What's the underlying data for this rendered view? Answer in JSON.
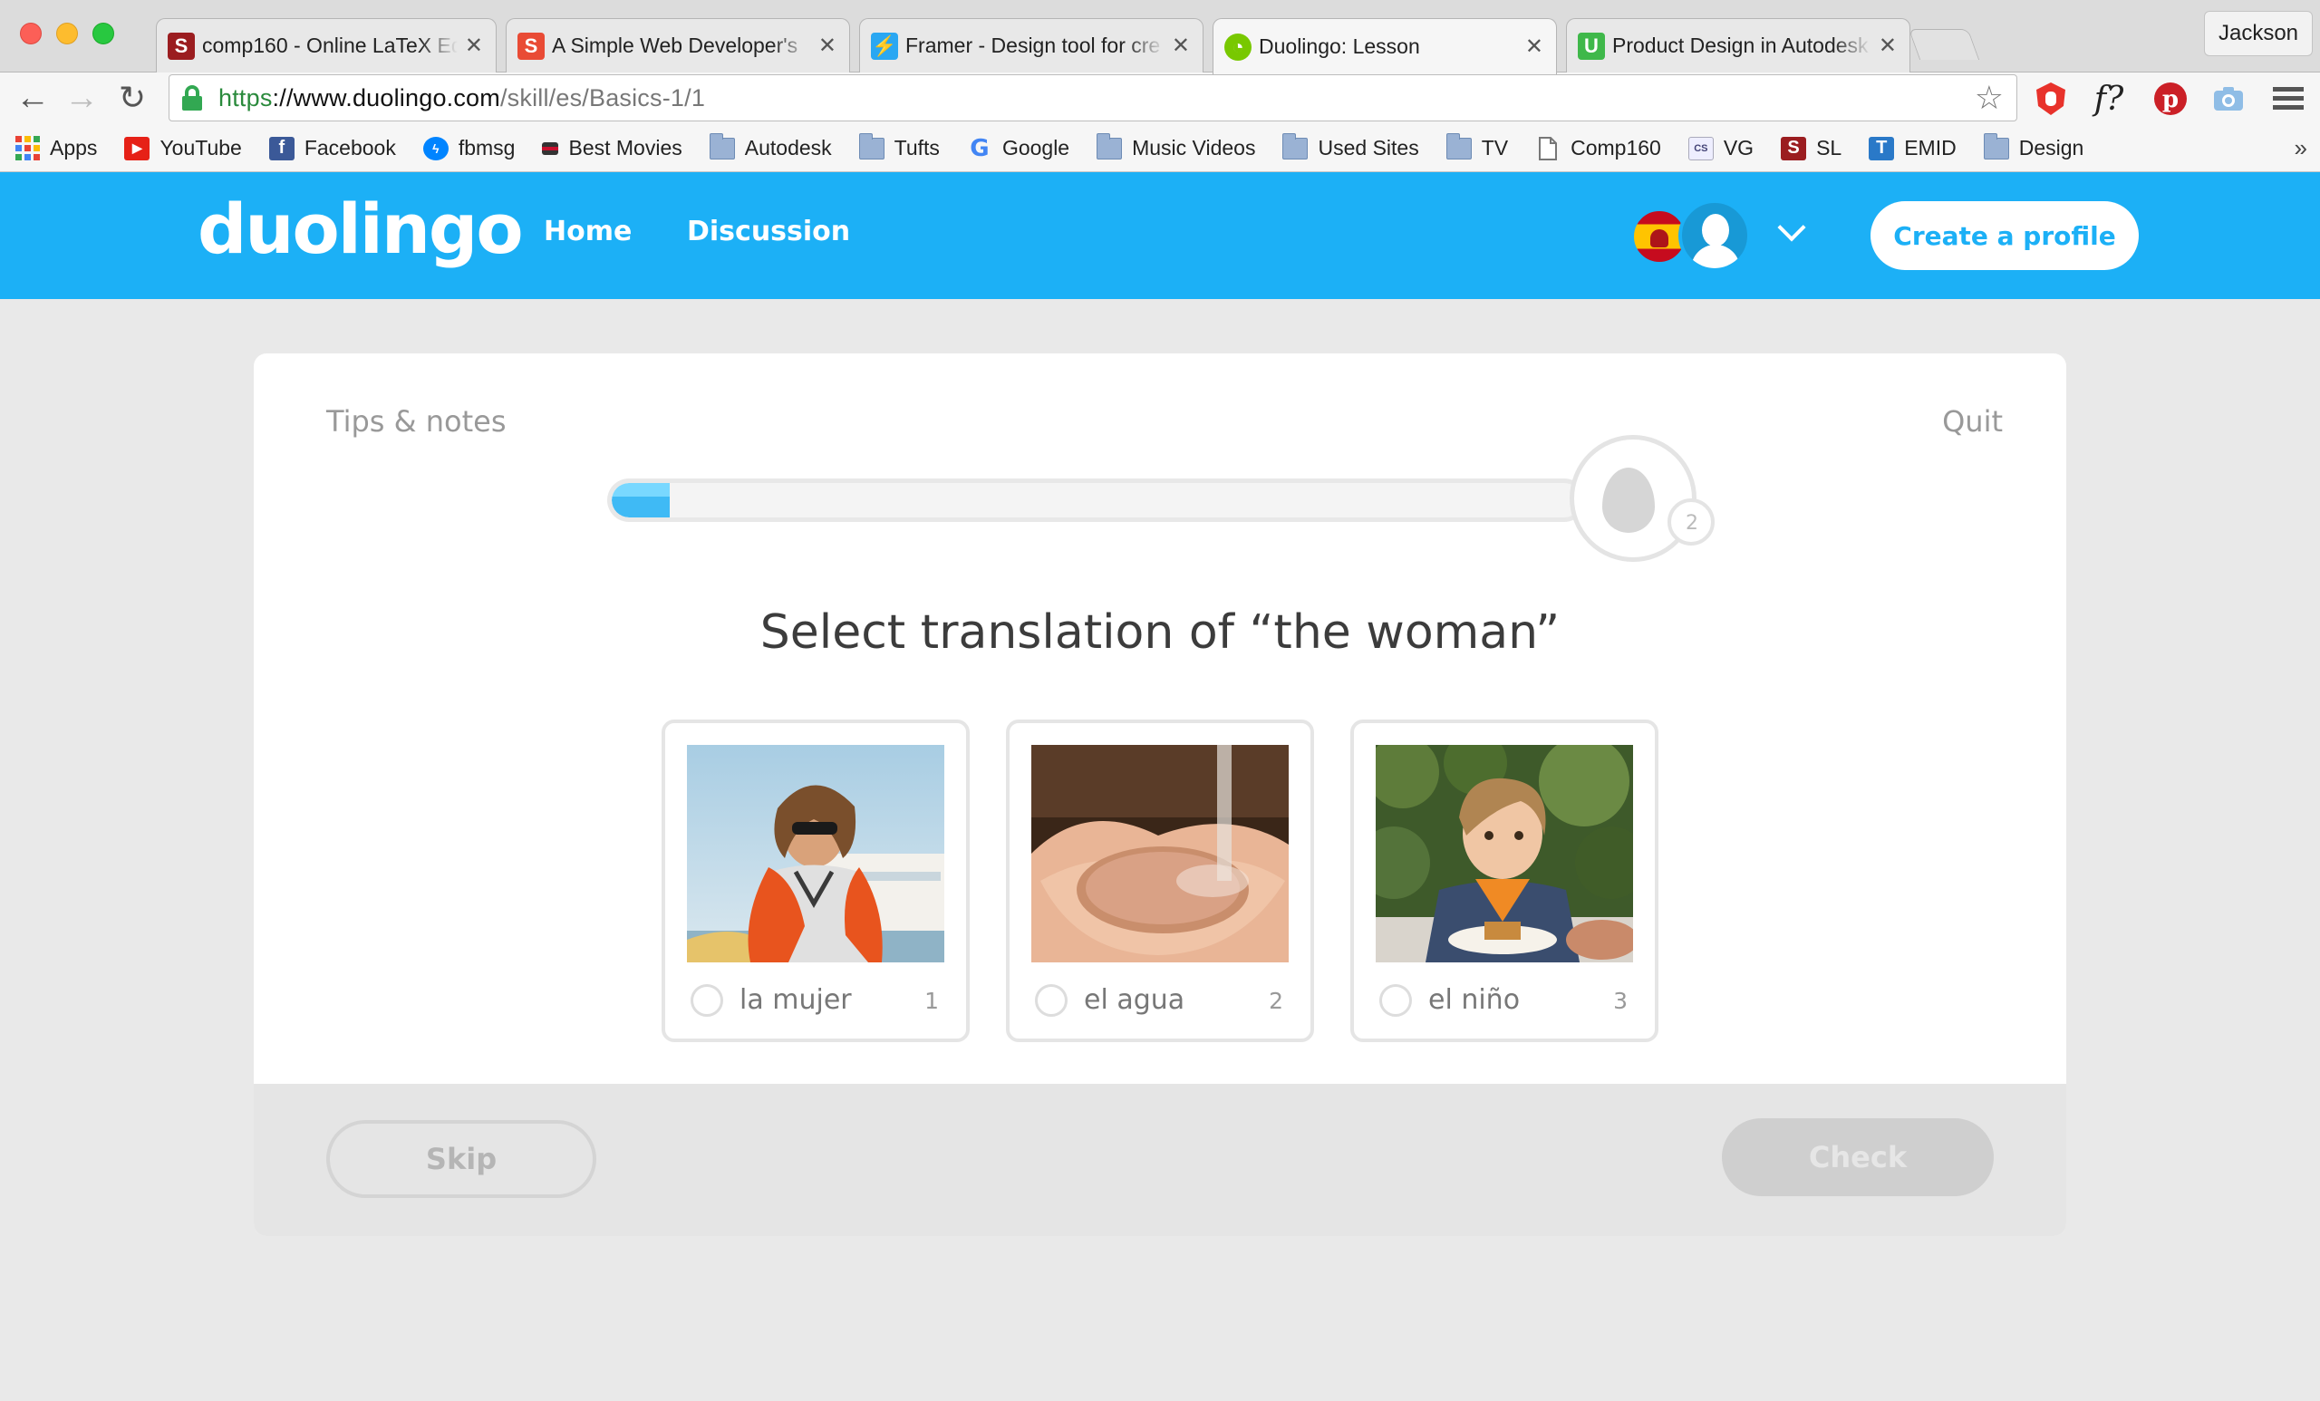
{
  "browser": {
    "window_controls": [
      "close",
      "minimize",
      "zoom"
    ],
    "profile_name": "Jackson",
    "tabs": [
      {
        "title": "comp160 - Online LaTeX Ed",
        "icon": "sharelatex-icon",
        "color": "#9b1d20",
        "active": false
      },
      {
        "title": "A Simple Web Developer's",
        "icon": "scotch-icon",
        "color": "#e94b35",
        "active": false
      },
      {
        "title": "Framer - Design tool for cre",
        "icon": "framer-icon",
        "color": "#2aa7f2",
        "active": false
      },
      {
        "title": "Duolingo: Lesson",
        "icon": "duolingo-owl-icon",
        "color": "#78c800",
        "active": true
      },
      {
        "title": "Product Design in Autodesk",
        "icon": "upwork-icon",
        "color": "#3fb84a",
        "active": false
      }
    ],
    "url": {
      "scheme": "https",
      "separator": "://",
      "host": "www.duolingo.com",
      "path": "/skill/es/Basics-1/1"
    },
    "bookmarks": [
      {
        "label": "Apps",
        "icon": "apps-grid-icon"
      },
      {
        "label": "YouTube",
        "icon": "youtube-icon"
      },
      {
        "label": "Facebook",
        "icon": "facebook-icon"
      },
      {
        "label": "fbmsg",
        "icon": "messenger-icon"
      },
      {
        "label": "Best Movies",
        "icon": "flag-icon"
      },
      {
        "label": "Autodesk",
        "icon": "folder-icon"
      },
      {
        "label": "Tufts",
        "icon": "folder-icon"
      },
      {
        "label": "Google",
        "icon": "google-icon"
      },
      {
        "label": "Music Videos",
        "icon": "folder-icon"
      },
      {
        "label": "Used Sites",
        "icon": "folder-icon"
      },
      {
        "label": "TV",
        "icon": "folder-icon"
      },
      {
        "label": "Comp160",
        "icon": "page-icon"
      },
      {
        "label": "VG",
        "icon": "cse-icon"
      },
      {
        "label": "SL",
        "icon": "sharelatex-icon"
      },
      {
        "label": "EMID",
        "icon": "t-icon"
      },
      {
        "label": "Design",
        "icon": "folder-icon"
      }
    ],
    "bookmarks_overflow": "»"
  },
  "site": {
    "logo": "duolingo",
    "nav": [
      {
        "label": "Home"
      },
      {
        "label": "Discussion"
      }
    ],
    "create_profile": "Create a profile",
    "brand_color": "#1cb0f6"
  },
  "lesson": {
    "tips": "Tips & notes",
    "quit": "Quit",
    "progress": 0.06,
    "lingots": "2",
    "prompt": "Select translation of “the woman”",
    "choices": [
      {
        "label": "la mujer",
        "number": "1",
        "image": "woman-photo"
      },
      {
        "label": "el agua",
        "number": "2",
        "image": "water-hands-photo"
      },
      {
        "label": "el niño",
        "number": "3",
        "image": "boy-photo"
      }
    ],
    "skip": "Skip",
    "check": "Check"
  }
}
